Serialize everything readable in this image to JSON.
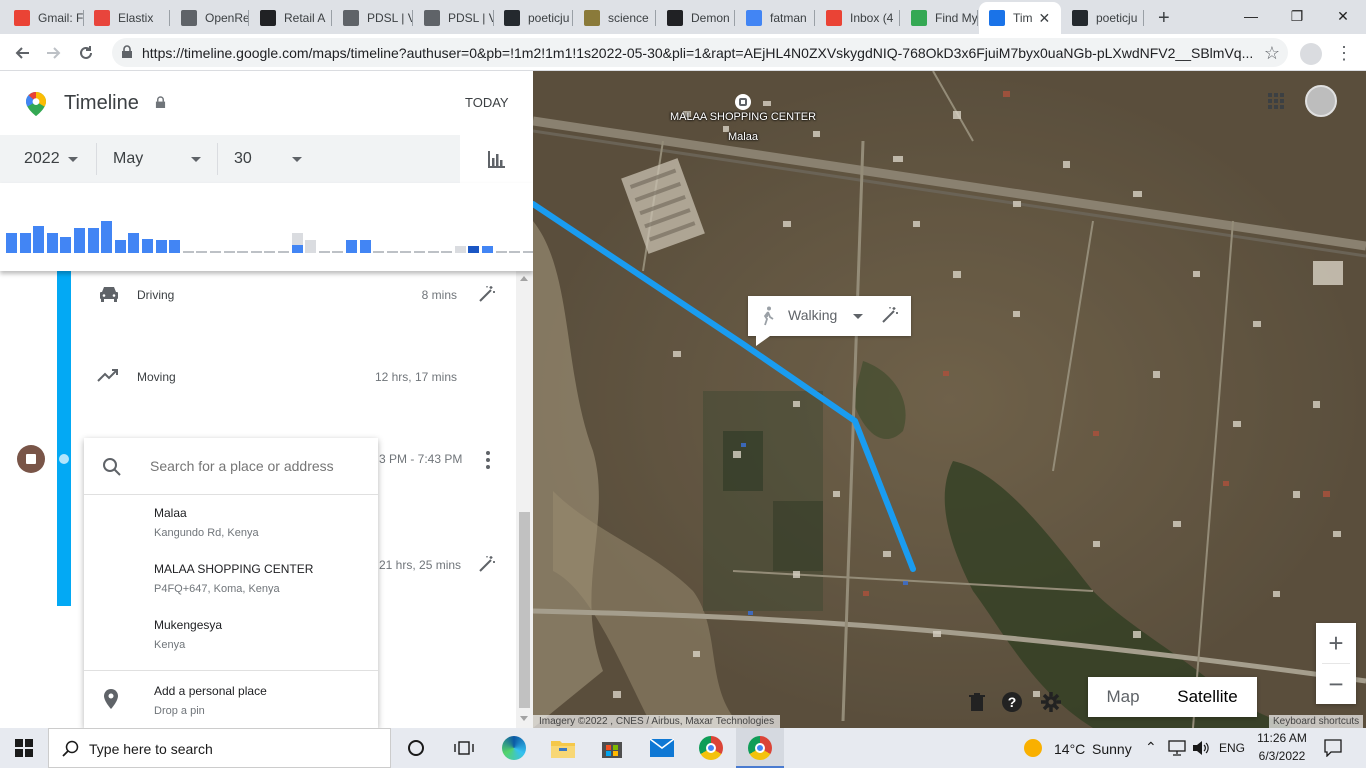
{
  "browser": {
    "tabs": [
      {
        "label": "Gmail: F",
        "icon": "gmail-icon",
        "color": "#ea4335"
      },
      {
        "label": "Elastix",
        "icon": "elastix-icon",
        "color": "#e8453c"
      },
      {
        "label": "OpenRe",
        "icon": "document-icon",
        "color": "#5f6368"
      },
      {
        "label": "Retail A",
        "icon": "ra-icon",
        "color": "#202124"
      },
      {
        "label": "PDSL | V",
        "icon": "document-icon",
        "color": "#5f6368"
      },
      {
        "label": "PDSL | V",
        "icon": "document-icon",
        "color": "#5f6368"
      },
      {
        "label": "poeticju",
        "icon": "github-icon",
        "color": "#24292e"
      },
      {
        "label": "science",
        "icon": "science-icon",
        "color": "#8a7a3a"
      },
      {
        "label": "Demon",
        "icon": "wikipedia-icon",
        "color": "#202124"
      },
      {
        "label": "fatman",
        "icon": "google-icon",
        "color": "#4285f4"
      },
      {
        "label": "Inbox (4",
        "icon": "gmail-icon",
        "color": "#ea4335"
      },
      {
        "label": "Find My",
        "icon": "find-my-icon",
        "color": "#34a853"
      },
      {
        "label": "Tim",
        "icon": "maps-pin-icon",
        "color": "#1a73e8"
      },
      {
        "label": "poeticju",
        "icon": "github-icon",
        "color": "#24292e"
      }
    ],
    "new_tab": "+",
    "close_glyph": "✕",
    "url": "https://timeline.google.com/maps/timeline?authuser=0&pb=!1m2!1m1!1s2022-05-30&pli=1&rapt=AEjHL4N0ZXVskygdNIQ-768OkD3x6FjuiM7byx0uaNGb-pLXwdNFV2__SBlmVq..."
  },
  "timeline": {
    "title": "Timeline",
    "today_label": "TODAY",
    "year": "2022",
    "month": "May",
    "day": "30",
    "histogram": {
      "bar_levels": [
        0.55,
        0.55,
        0.75,
        0.55,
        0.45,
        0.7,
        0.7,
        0.9,
        0.35,
        0.55,
        0.4,
        0.35,
        0.35,
        0.05,
        0.05,
        0.05,
        0.05,
        0.05,
        0.05,
        0.05,
        0.05,
        0.55,
        0.35,
        0.05,
        0.05,
        0.35,
        0.35,
        0.05,
        0.05,
        0.05,
        0.05,
        0.05,
        0.05,
        0.2,
        0.2,
        0.2,
        0.05,
        0.05,
        0.05,
        0.05
      ],
      "bar_tones": [
        "blue",
        "blue",
        "blue",
        "blue",
        "blue",
        "blue",
        "blue",
        "blue",
        "blue",
        "blue",
        "blue",
        "blue",
        "blue",
        "grey",
        "grey",
        "grey",
        "grey",
        "grey",
        "grey",
        "grey",
        "grey",
        "mixed",
        "lightgrey",
        "grey",
        "grey",
        "blue",
        "blue",
        "grey",
        "grey",
        "grey",
        "grey",
        "grey",
        "grey",
        "lightgrey",
        "dark",
        "blue",
        "grey",
        "grey",
        "grey",
        "grey"
      ],
      "colors": {
        "blue": "#4285f4",
        "dark": "#1a56c4",
        "grey": "#bdc1c6",
        "lightgrey": "#dadce0"
      }
    },
    "segments": [
      {
        "label": "Driving",
        "duration": "8 mins"
      },
      {
        "label": "Moving",
        "duration": "12 hrs, 17 mins"
      }
    ],
    "visit_time": "3 PM - 7:43 PM",
    "second_duration": "21 hrs, 25 mins"
  },
  "search": {
    "placeholder": "Search for a place or address",
    "suggestions": [
      {
        "title": "Malaa",
        "subtitle": "Kangundo Rd, Kenya"
      },
      {
        "title": "MALAA SHOPPING CENTER",
        "subtitle": "P4FQ+647, Koma, Kenya"
      },
      {
        "title": "Mukengesya",
        "subtitle": "Kenya"
      }
    ],
    "personal": {
      "title": "Add a personal place",
      "subtitle": "Drop a pin"
    }
  },
  "map": {
    "poi_name": "MALAA SHOPPING CENTER",
    "poi_sub": "Malaa",
    "mode_label": "Walking",
    "map_btn": "Map",
    "satellite_btn": "Satellite",
    "zoom_in": "+",
    "zoom_out": "−",
    "attribution": "Imagery ©2022 , CNES / Airbus, Maxar Technologies",
    "shortcuts": "Keyboard shortcuts",
    "route_color": "#1a9cf0"
  },
  "taskbar": {
    "search_placeholder": "Type here to search",
    "weather_temp": "14°C",
    "weather_text": "Sunny",
    "lang": "ENG",
    "time": "11:26 AM",
    "date": "6/3/2022"
  }
}
